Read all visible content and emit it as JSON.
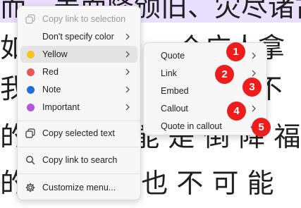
{
  "document_lines": [
    "而，表面降颁旧、灾尽诸古",
    "如 功        我加，一个广人拿",
    "我 清        是 人, 命 即 知 不",
    "的 痛，        为 能 是 倒 降 福 的",
    "的 经        永 远 也 不 可 能"
  ],
  "context_menu": {
    "items": [
      {
        "label": "Copy link to selection",
        "icon": "copy-icon",
        "disabled": true
      },
      {
        "label": "Don't specify color",
        "submenu": true
      },
      {
        "label": "Yellow",
        "icon": "yellow-dot-icon",
        "color": "#f5c518",
        "submenu": true,
        "hovered": true
      },
      {
        "label": "Red",
        "icon": "red-dot-icon",
        "color": "#e8575a",
        "submenu": true
      },
      {
        "label": "Note",
        "icon": "blue-dot-icon",
        "color": "#1f6fd6",
        "submenu": true
      },
      {
        "label": "Important",
        "icon": "purple-dot-icon",
        "color": "#b156db",
        "submenu": true
      },
      {
        "label": "Copy selected text",
        "icon": "copy-icon"
      },
      {
        "label": "Copy link to search",
        "icon": "search-icon"
      },
      {
        "label": "Customize menu...",
        "icon": "gear-icon"
      }
    ]
  },
  "submenu": {
    "items": [
      {
        "label": "Quote",
        "submenu": true
      },
      {
        "label": "Link",
        "submenu": true
      },
      {
        "label": "Embed"
      },
      {
        "label": "Callout",
        "submenu": true
      },
      {
        "label": "Quote in callout",
        "checked": true
      }
    ]
  },
  "badges": [
    "1",
    "2",
    "3",
    "4",
    "5"
  ],
  "colors": {
    "badge": "#ee1c1c",
    "highlight": "#e9dfff"
  }
}
